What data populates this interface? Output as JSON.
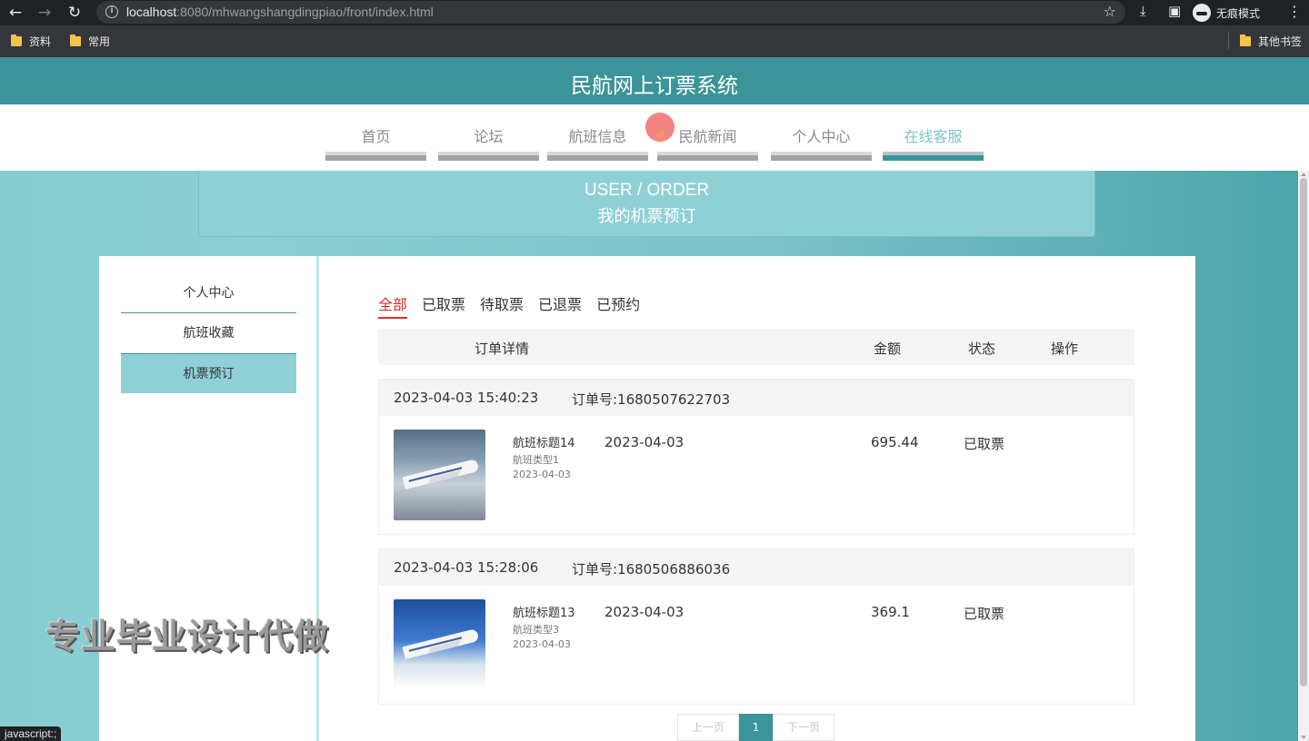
{
  "browser": {
    "url_host": "localhost",
    "url_rest": ":8080/mhwangshangdingpiao/front/index.html",
    "incognito_label": "无痕模式",
    "bookmarks": [
      "资料",
      "常用"
    ],
    "other_bookmarks": "其他书签",
    "status_text": "javascript:;"
  },
  "header": {
    "site_title": "民航网上订票系统"
  },
  "nav": {
    "items": [
      "首页",
      "论坛",
      "航班信息",
      "民航新闻",
      "个人中心",
      "在线客服"
    ],
    "active_index": 5
  },
  "banner": {
    "en": "USER / ORDER",
    "cn": "我的机票预订"
  },
  "sidebar": {
    "items": [
      "个人中心",
      "航班收藏",
      "机票预订"
    ],
    "active_index": 2
  },
  "tabs": [
    "全部",
    "已取票",
    "待取票",
    "已退票",
    "已预约"
  ],
  "table_header": {
    "detail": "订单详情",
    "amount": "金额",
    "status": "状态",
    "action": "操作"
  },
  "orders": [
    {
      "created_at": "2023-04-03 15:40:23",
      "order_no": "订单号:1680507622703",
      "flight_title": "航班标题14",
      "flight_type": "航班类型1",
      "flight_date": "2023-04-03",
      "date": "2023-04-03",
      "amount": "695.44",
      "status": "已取票"
    },
    {
      "created_at": "2023-04-03 15:28:06",
      "order_no": "订单号:1680506886036",
      "flight_title": "航班标题13",
      "flight_type": "航班类型3",
      "flight_date": "2023-04-03",
      "date": "2023-04-03",
      "amount": "369.1",
      "status": "已取票"
    }
  ],
  "pagination": {
    "prev": "上一页",
    "current": "1",
    "next": "下一页"
  },
  "watermark": "专业毕业设计代做",
  "icons": {
    "back": "arrow-left-icon",
    "forward": "arrow-right-icon",
    "reload": "reload-icon",
    "info": "info-icon",
    "bookmark": "star-icon",
    "download": "download-icon",
    "sidepanel": "sidepanel-icon",
    "incognito": "incognito-icon",
    "menu": "kebab-menu-icon",
    "folder": "folder-icon"
  },
  "colors": {
    "brand": "#3a9499",
    "active_tab": "#d9302c",
    "banner": "#8fd0d6"
  }
}
